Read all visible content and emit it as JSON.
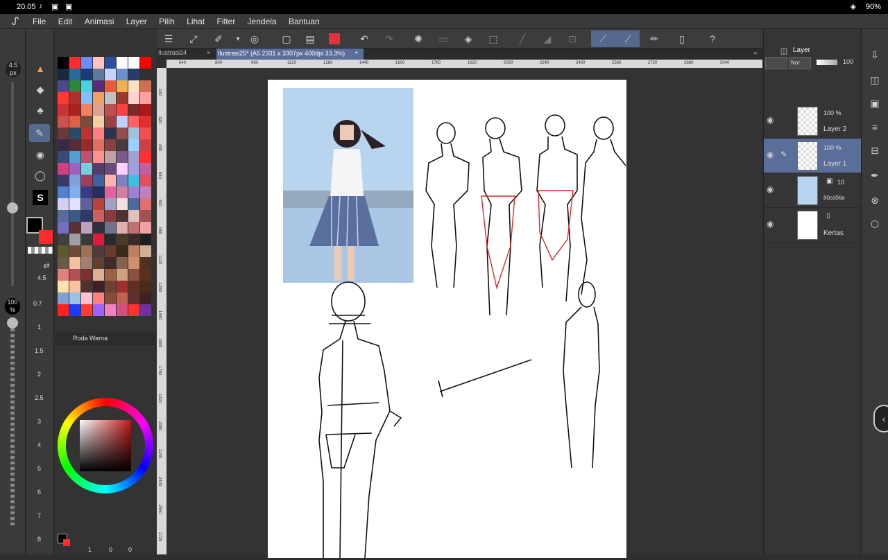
{
  "status": {
    "time": "20.05",
    "battery": "90%"
  },
  "menu": [
    "File",
    "Edit",
    "Animasi",
    "Layer",
    "Pilih",
    "Lihat",
    "Filter",
    "Jendela",
    "Bantuan"
  ],
  "brush": {
    "size_label": "4.5",
    "size_unit": "px",
    "size_value": "4.5",
    "opacity": "100",
    "opacity_unit": "%"
  },
  "size_list": [
    "0.7",
    "1",
    "1.5",
    "2",
    "2.5",
    "3",
    "4",
    "5",
    "6",
    "7",
    "8"
  ],
  "tabs": [
    {
      "label": "Ilustrasi24"
    },
    {
      "label": "Ilustrasi25* (A5 2331 x 3307px 400dpi 33.3%)"
    }
  ],
  "color_wheel_title": "Roda Warna",
  "layers": {
    "title": "Layer",
    "opacity": "100",
    "blend": "Nor",
    "items": [
      {
        "name": "Layer 2",
        "pct": "100 %"
      },
      {
        "name": "Layer 1",
        "pct": "100 %"
      },
      {
        "name": "80cd06e",
        "pct": "10"
      },
      {
        "name": "Kertas",
        "pct": ""
      }
    ]
  },
  "bottom_counters": [
    "1",
    "0",
    "0"
  ],
  "ruler_h": [
    "640",
    "800",
    "960",
    "1120",
    "1280",
    "1440",
    "1600",
    "1760",
    "1920",
    "2080",
    "2240",
    "2400",
    "2560",
    "2720",
    "2880",
    "3040"
  ],
  "ruler_v": [
    "160",
    "320",
    "480",
    "640",
    "800",
    "960",
    "1120",
    "1280",
    "1440",
    "1600",
    "1760",
    "1920",
    "2080",
    "2240",
    "2400",
    "2560",
    "2720"
  ],
  "colors": {
    "main": "#000000",
    "sub": "#ff2a2a",
    "accent": "#5b6e99"
  }
}
